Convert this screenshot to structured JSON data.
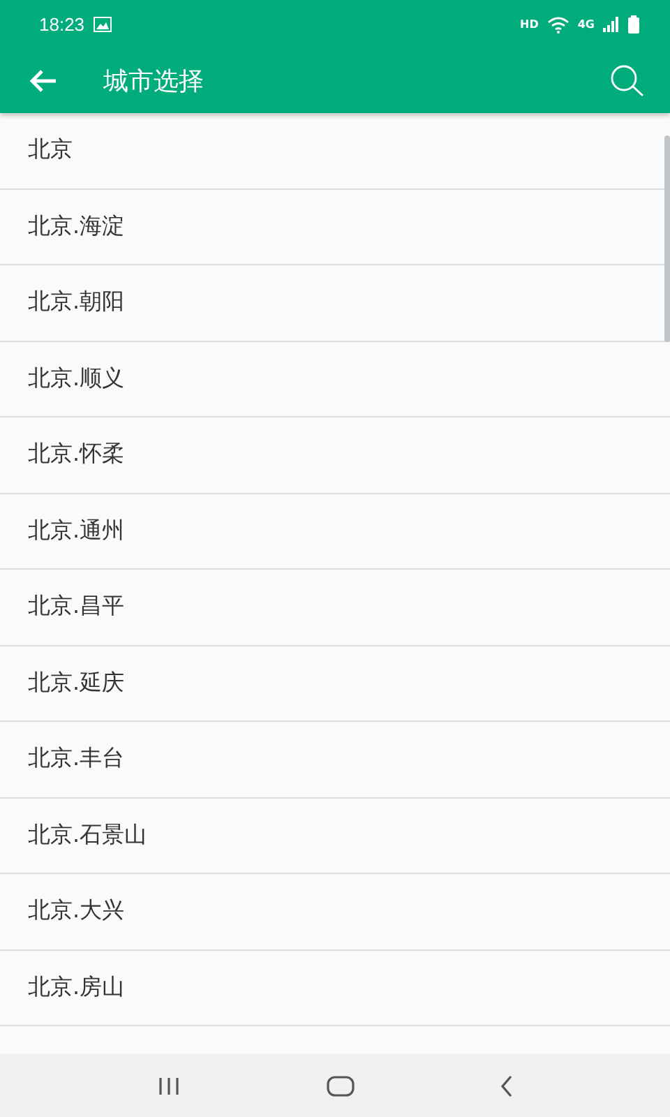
{
  "status_bar": {
    "time": "18:23",
    "network_label": "HD",
    "cellular_label": "4G"
  },
  "app_bar": {
    "title": "城市选择"
  },
  "cities": [
    "北京",
    "北京.海淀",
    "北京.朝阳",
    "北京.顺义",
    "北京.怀柔",
    "北京.通州",
    "北京.昌平",
    "北京.延庆",
    "北京.丰台",
    "北京.石景山",
    "北京.大兴",
    "北京.房山"
  ]
}
